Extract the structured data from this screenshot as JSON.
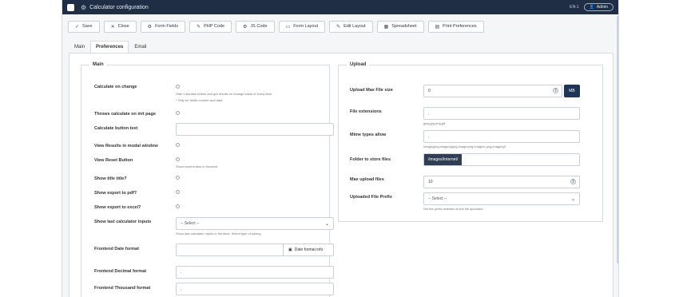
{
  "header": {
    "title": "Calculator configuration",
    "link": "EN-1",
    "user": "Admin"
  },
  "toolbar": {
    "buttons": [
      "Save",
      "Close",
      "Form Fields",
      "PHP Code",
      "JS Code",
      "Form Layout",
      "Edit Layout",
      "Spreadsheet",
      "Print Preferences"
    ],
    "icons": [
      "save-icon",
      "close-icon",
      "fields-icon",
      "php-icon",
      "js-icon",
      "layout-icon",
      "edit-icon",
      "spreadsheet-icon",
      "print-icon"
    ]
  },
  "tabs": [
    "Main",
    "Preferences",
    "Email"
  ],
  "active_tab": "Preferences",
  "main": {
    "legend": "Main",
    "calculate_on_change": {
      "label": "Calculate on change",
      "hint1": "Hide Calculate button and get results on change value of every field",
      "hint2": "* Only for fields number and data"
    },
    "throws_calculate": {
      "label": "Throws calculate on init page"
    },
    "calculate_button_text": {
      "label": "Calculate button text",
      "value": ""
    },
    "view_results_modal": {
      "label": "View Results in modal window"
    },
    "view_reset_button": {
      "label": "View Reset Button",
      "hint": "Show reset button in frontend"
    },
    "show_title": {
      "label": "Show title title?"
    },
    "show_export_pdf": {
      "label": "Show export to pdf?"
    },
    "show_export_excel": {
      "label": "Show export to excel?"
    },
    "show_last_inputs": {
      "label": "Show last calculator inputs",
      "value": "-- Select --",
      "hint": "Show last calculator inputs in frontend. Select type of saving"
    },
    "frontend_date_format": {
      "label": "Frontend Date format",
      "value": "",
      "button": "Date format info"
    },
    "frontend_decimal_format": {
      "label": "Frontend Decimal format",
      "value": "."
    },
    "frontend_thousand_format": {
      "label": "Frontend Thousand format",
      "value": ","
    }
  },
  "upload": {
    "legend": "Upload",
    "max_file_size": {
      "label": "Upload Max File size",
      "value": "0",
      "button": "MB"
    },
    "file_extensions": {
      "label": "File extensions",
      "value": ",",
      "hint": "jpeg,jpg,png,gif"
    },
    "mime_types": {
      "label": "Mime types allow",
      "value": ",",
      "hint": "image/jpeg,image/pjpeg,image/png,image/x-png,image/gif"
    },
    "folder": {
      "label": "Folder to store files",
      "value": "/images/Internet/"
    },
    "max_upload_files": {
      "label": "Max upload files",
      "value": "10"
    },
    "file_prefix": {
      "label": "Uploaded File Prefix",
      "value": "-- Select --",
      "hint": "Set the prefix selected to the file uploaded"
    }
  }
}
